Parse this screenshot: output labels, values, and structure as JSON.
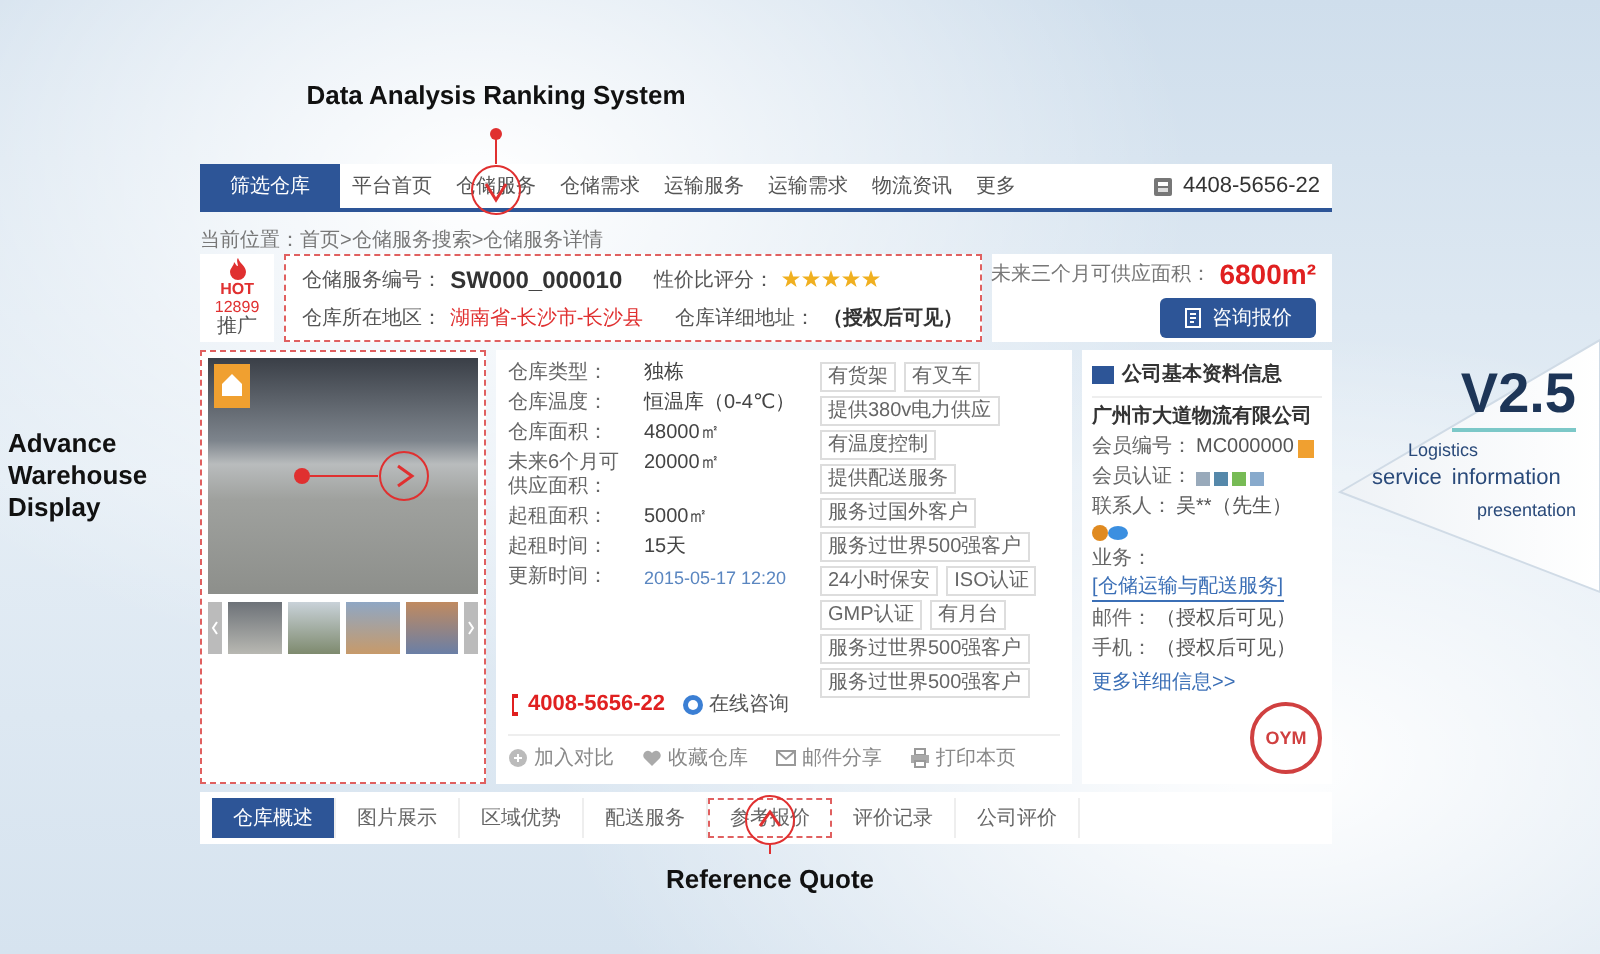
{
  "annotations": [
    {
      "kind": "top",
      "label": "Data Analysis Ranking System"
    },
    {
      "kind": "left",
      "label": "Advance Warehouse Display"
    },
    {
      "kind": "bottom",
      "label": "Reference Quote"
    }
  ],
  "nav": {
    "items": [
      {
        "label": "筛选仓库",
        "selected": true
      },
      {
        "label": "平台首页",
        "selected": false
      },
      {
        "label": "仓储服务",
        "selected": false
      },
      {
        "label": "仓储需求",
        "selected": false
      },
      {
        "label": "运输服务",
        "selected": false
      },
      {
        "label": "运输需求",
        "selected": false
      },
      {
        "label": "物流资讯",
        "selected": false
      },
      {
        "label": "更多",
        "selected": false
      }
    ],
    "phone": "4408-5656-22"
  },
  "breadcrumb": "当前位置：首页>仓储服务搜索>仓储服务详情",
  "header": {
    "hot_label": "HOT",
    "hot_count": "12899",
    "hot_caption": "推广",
    "service_no_label": "仓储服务编号：",
    "service_no": "SW000_000010",
    "rating_label": "性价比评分：",
    "stars": 5,
    "region_label": "仓库所在地区：",
    "region": "湖南省-长沙市-长沙县",
    "address_label": "仓库详细地址：",
    "address": "（授权后可见）",
    "area_label": "未来三个月可供应面积：",
    "area": "6800m²",
    "button": "咨询报价"
  },
  "specs": [
    {
      "label": "仓库类型：",
      "value": "独栋",
      "kind": "plain"
    },
    {
      "label": "仓库温度：",
      "value": "恒温库（0-4℃）",
      "kind": "plain"
    },
    {
      "label": "仓库面积：",
      "value": "48000㎡",
      "kind": "plain"
    },
    {
      "label": "未来6个月可供应面积：",
      "value": "20000㎡",
      "kind": "plain"
    },
    {
      "label": "起租面积：",
      "value": "5000㎡",
      "kind": "plain"
    },
    {
      "label": "起租时间：",
      "value": "15天",
      "kind": "plain"
    },
    {
      "label": "更新时间：",
      "value": "2015-05-17 12:20",
      "kind": "date"
    }
  ],
  "tags": [
    "有货架",
    "有叉车",
    "提供380v电力供应",
    "有温度控制",
    "提供配送服务",
    "服务过国外客户",
    "服务过世界500强客户",
    "24小时保安",
    "ISO认证",
    "GMP认证",
    "有月台",
    "服务过世界500强客户",
    "服务过世界500强客户"
  ],
  "contact": {
    "phone": "4008-5656-22",
    "chat": "在线咨询"
  },
  "actions": [
    {
      "kind": "compare",
      "label": "加入对比"
    },
    {
      "kind": "favorite",
      "label": "收藏仓库"
    },
    {
      "kind": "mail",
      "label": "邮件分享"
    },
    {
      "kind": "print",
      "label": "打印本页"
    }
  ],
  "company": {
    "title": "公司基本资料信息",
    "name": "广州市大道物流有限公司",
    "rows": [
      {
        "kind": "id",
        "label": "会员编号：",
        "value": "MC000000"
      },
      {
        "kind": "certs",
        "label": "会员认证："
      },
      {
        "kind": "person",
        "label": "联系人：",
        "value": "吴**（先生）"
      },
      {
        "kind": "link",
        "label": "业务：",
        "value": "[仓储运输与配送服务]"
      },
      {
        "kind": "plain",
        "label": "邮件：",
        "value": "（授权后可见）"
      },
      {
        "kind": "plain",
        "label": "手机：",
        "value": "（授权后可见）"
      }
    ],
    "more": "更多详细信息>>",
    "stamp": "OYM"
  },
  "tabs": [
    {
      "label": "仓库概述",
      "selected": true,
      "highlighted": false
    },
    {
      "label": "图片展示",
      "selected": false,
      "highlighted": false
    },
    {
      "label": "区域优势",
      "selected": false,
      "highlighted": false
    },
    {
      "label": "配送服务",
      "selected": false,
      "highlighted": false
    },
    {
      "label": "参考报价",
      "selected": false,
      "highlighted": true
    },
    {
      "label": "评价记录",
      "selected": false,
      "highlighted": false
    },
    {
      "label": "公司评价",
      "selected": false,
      "highlighted": false
    }
  ],
  "badge": {
    "version": "V2.5",
    "line_1": "Logistics",
    "line_2": "service information",
    "line_3": "presentation"
  }
}
